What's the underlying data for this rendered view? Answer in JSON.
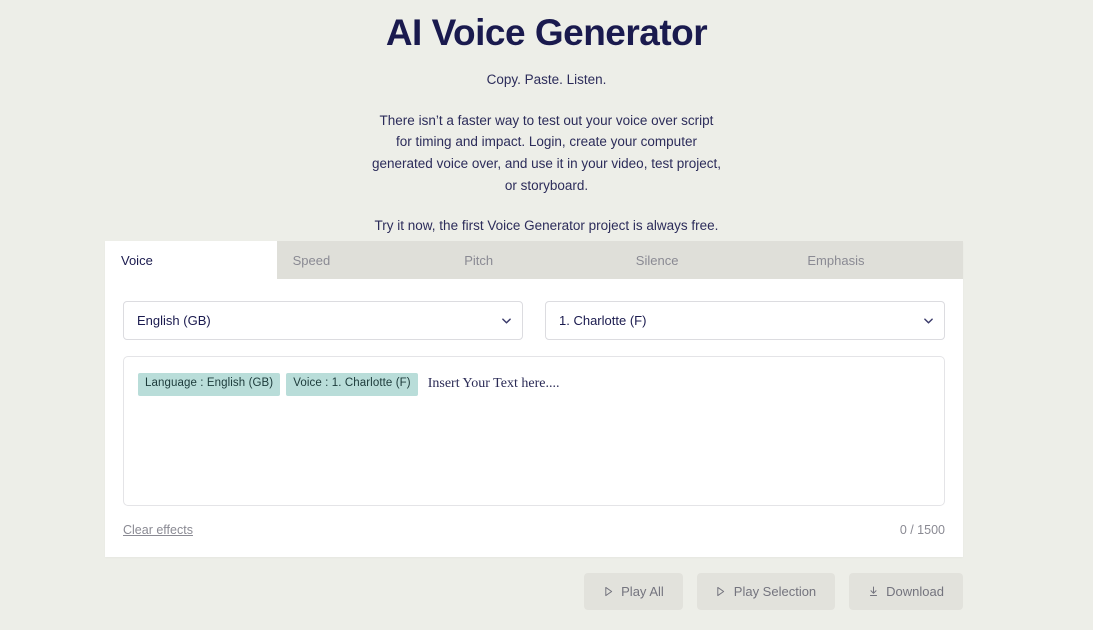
{
  "hero": {
    "title": "AI Voice Generator",
    "tagline": "Copy. Paste. Listen.",
    "body": "There isn’t a faster way to test out your voice over script for timing and impact. Login, create your computer generated voice over, and use it in your video, test project, or storyboard.",
    "cta": "Try it now, the first Voice Generator project is always free."
  },
  "tabs": [
    {
      "label": "Voice",
      "active": true
    },
    {
      "label": "Speed",
      "active": false
    },
    {
      "label": "Pitch",
      "active": false
    },
    {
      "label": "Silence",
      "active": false
    },
    {
      "label": "Emphasis",
      "active": false
    }
  ],
  "controls": {
    "language_select": {
      "value": "English (GB)",
      "icon": "chevron-down-icon"
    },
    "voice_select": {
      "value": "1. Charlotte (F)",
      "icon": "chevron-down-icon"
    }
  },
  "editor": {
    "chips": [
      "Language : English (GB)",
      "Voice : 1. Charlotte (F)"
    ],
    "placeholder": "Insert Your Text here...."
  },
  "footer": {
    "clear_label": "Clear effects",
    "counter": "0 / 1500"
  },
  "actions": [
    {
      "label": "Play All",
      "icon": "play-icon"
    },
    {
      "label": "Play Selection",
      "icon": "play-icon"
    },
    {
      "label": "Download",
      "icon": "download-icon"
    }
  ],
  "colors": {
    "page_background": "#edeee8",
    "card_background": "#ffffff",
    "tab_inactive_background": "#dfdfd9",
    "title": "#1a1a4e",
    "chip_background": "#b9ddd9",
    "button_background": "#e2e2dc",
    "muted_text": "#8a8a93"
  }
}
